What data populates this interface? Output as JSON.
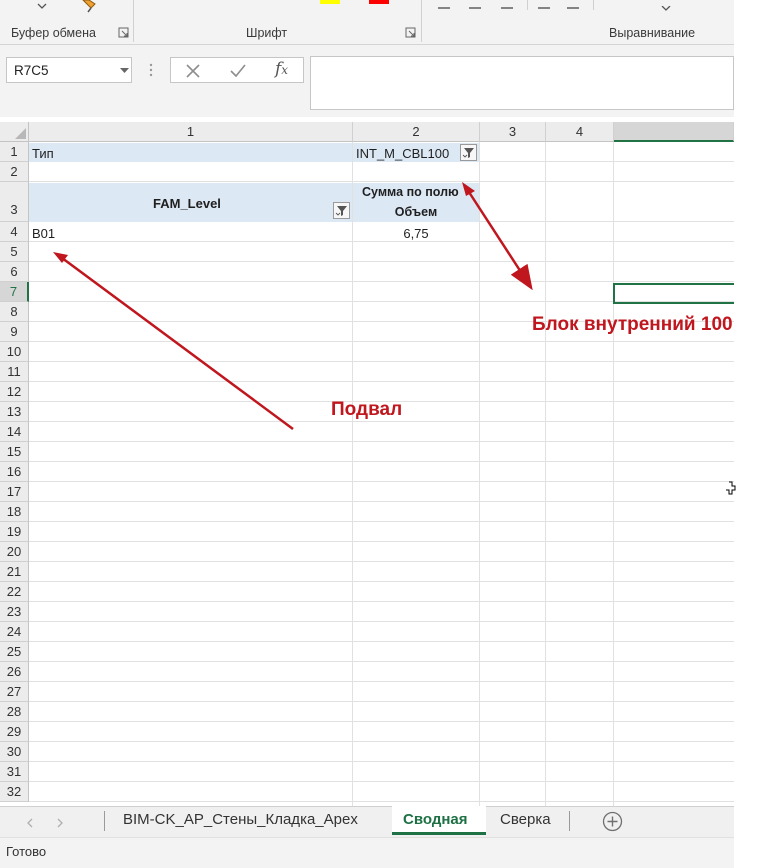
{
  "ribbon": {
    "groups": [
      "Буфер обмена",
      "Шрифт",
      "Выравнивание"
    ],
    "colors": {
      "highlight": "#ffff00",
      "font_color": "#ff0000"
    }
  },
  "formula_bar": {
    "name_box": "R7C5",
    "cancel_icon": "close-icon",
    "enter_icon": "check-icon",
    "function_icon": "fx-icon",
    "value": ""
  },
  "grid": {
    "columns": [
      "1",
      "2",
      "3",
      "4"
    ],
    "rows": [
      "1",
      "2",
      "3",
      "4",
      "5",
      "6",
      "7",
      "8",
      "9",
      "10",
      "11",
      "12",
      "13",
      "14",
      "15",
      "16",
      "17",
      "18",
      "19",
      "20",
      "21",
      "22",
      "23",
      "24",
      "25",
      "26",
      "27",
      "28",
      "29",
      "30",
      "31",
      "32"
    ],
    "selected_row": "7",
    "pivot": {
      "filter_label": "Тип",
      "filter_value": "INT_M_CBL100",
      "row_field": "FAM_Level",
      "value_field_line1": "Сумма по полю",
      "value_field_line2": "Объем",
      "data_label": "В01",
      "data_value": "6,75"
    }
  },
  "annotations": {
    "block_label": "Блок внутренний 100",
    "footer_label": "Подвал",
    "color": "#c0161e"
  },
  "sheet_tabs": {
    "tabs": [
      "BIM-CK_AP_Стены_Кладка_Apex",
      "Сводная",
      "Сверка"
    ],
    "active": "Сводная",
    "active_color": "#1e7145"
  },
  "status": {
    "text": "Готово"
  }
}
